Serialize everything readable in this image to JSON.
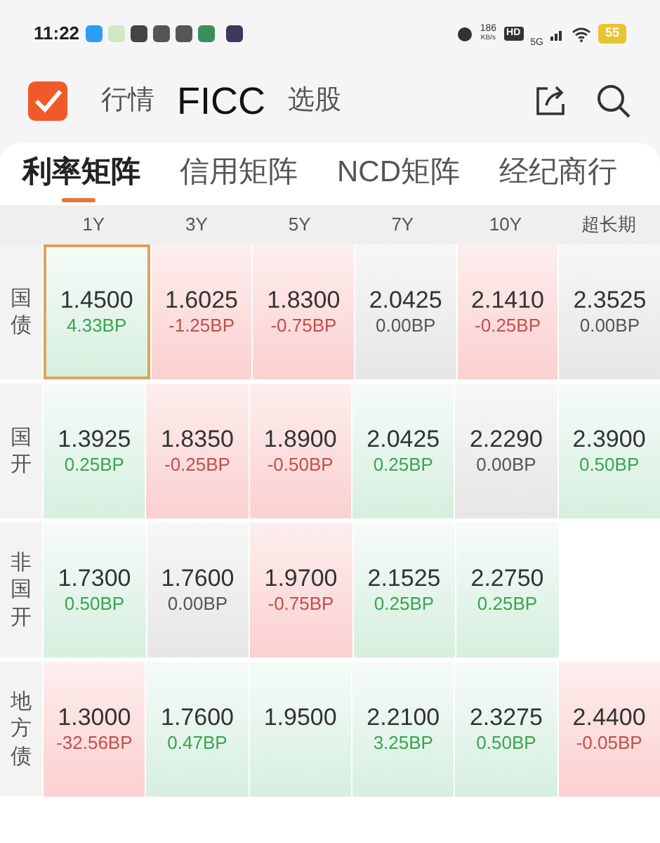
{
  "status_bar": {
    "time": "11:22",
    "speed": "186",
    "speed_unit": "KB/s",
    "hd": "HD",
    "network": "5G",
    "battery": "55"
  },
  "header": {
    "nav": [
      {
        "label": "行情",
        "selected": false
      },
      {
        "label": "FICC",
        "selected": true
      },
      {
        "label": "选股",
        "selected": false
      }
    ]
  },
  "tabs": [
    {
      "label": "利率矩阵",
      "selected": true
    },
    {
      "label": "信用矩阵",
      "selected": false
    },
    {
      "label": "NCD矩阵",
      "selected": false
    },
    {
      "label": "经纪商行",
      "selected": false
    }
  ],
  "table": {
    "columns": [
      "1Y",
      "3Y",
      "5Y",
      "7Y",
      "10Y",
      "超长期"
    ],
    "rows": [
      {
        "label": "国债",
        "cells": [
          {
            "value": "1.4500",
            "change": "4.33BP",
            "kind": "up",
            "selected": true
          },
          {
            "value": "1.6025",
            "change": "-1.25BP",
            "kind": "down",
            "selected": false
          },
          {
            "value": "1.8300",
            "change": "-0.75BP",
            "kind": "down",
            "selected": false
          },
          {
            "value": "2.0425",
            "change": "0.00BP",
            "kind": "flat",
            "selected": false
          },
          {
            "value": "2.1410",
            "change": "-0.25BP",
            "kind": "down",
            "selected": false
          },
          {
            "value": "2.3525",
            "change": "0.00BP",
            "kind": "flat",
            "selected": false
          }
        ]
      },
      {
        "label": "国开",
        "cells": [
          {
            "value": "1.3925",
            "change": "0.25BP",
            "kind": "up",
            "selected": false
          },
          {
            "value": "1.8350",
            "change": "-0.25BP",
            "kind": "down",
            "selected": false
          },
          {
            "value": "1.8900",
            "change": "-0.50BP",
            "kind": "down",
            "selected": false
          },
          {
            "value": "2.0425",
            "change": "0.25BP",
            "kind": "up",
            "selected": false
          },
          {
            "value": "2.2290",
            "change": "0.00BP",
            "kind": "flat",
            "selected": false
          },
          {
            "value": "2.3900",
            "change": "0.50BP",
            "kind": "up",
            "selected": false
          }
        ]
      },
      {
        "label": "非国开",
        "cells": [
          {
            "value": "1.7300",
            "change": "0.50BP",
            "kind": "up",
            "selected": false
          },
          {
            "value": "1.7600",
            "change": "0.00BP",
            "kind": "flat",
            "selected": false
          },
          {
            "value": "1.9700",
            "change": "-0.75BP",
            "kind": "down",
            "selected": false
          },
          {
            "value": "2.1525",
            "change": "0.25BP",
            "kind": "up",
            "selected": false
          },
          {
            "value": "2.2750",
            "change": "0.25BP",
            "kind": "up",
            "selected": false
          }
        ]
      },
      {
        "label": "地方债",
        "cells": [
          {
            "value": "1.3000",
            "change": "-32.56BP",
            "kind": "down",
            "selected": false
          },
          {
            "value": "1.7600",
            "change": "0.47BP",
            "kind": "up",
            "selected": false
          },
          {
            "value": "1.9500",
            "kind": "up",
            "selected": false
          },
          {
            "value": "2.2100",
            "change": "3.25BP",
            "kind": "up",
            "selected": false
          },
          {
            "value": "2.3275",
            "change": "0.50BP",
            "kind": "up",
            "selected": false
          },
          {
            "value": "2.4400",
            "change": "-0.05BP",
            "kind": "down",
            "selected": false
          }
        ]
      }
    ]
  }
}
